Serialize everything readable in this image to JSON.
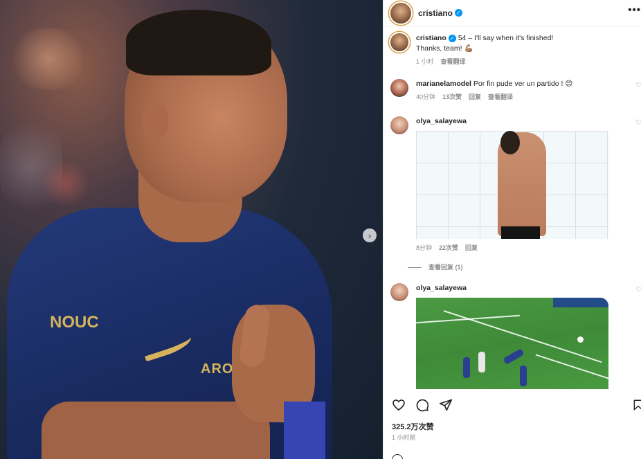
{
  "post": {
    "author": "cristiano",
    "verified_mark": "✓",
    "more_label": "•••",
    "caption": {
      "username": "cristiano",
      "line1": "54 – I'll say when it's finished!",
      "line2": "Thanks, team! 💪🏽",
      "time": "1 小时"
    },
    "photo": {
      "sleeve_logo": "NOUC",
      "sponsor": "AROM"
    },
    "next_label": "›"
  },
  "ui": {
    "translate_label": "查看翻译",
    "reply_label": "回复",
    "view_replies_label": "查看回复 (1)"
  },
  "comments": [
    {
      "username": "marianelamodel",
      "text": "Por fin pude ver un partido ! 😍",
      "time": "40分钟",
      "likes": "13次赞"
    },
    {
      "username": "olya_salayewa",
      "media": "gif-photo",
      "time": "8分钟",
      "likes": "22次赞"
    },
    {
      "username": "olya_salayewa",
      "media": "football-clip"
    }
  ],
  "icons": {
    "like": "heart-icon",
    "comment": "comment-icon",
    "share": "share-icon",
    "save": "bookmark-icon"
  },
  "footer": {
    "likes": "325.2万次赞",
    "time": "1 小时前"
  },
  "colors": {
    "verified": "#0095f6",
    "text": "#262626",
    "muted": "#8e8e8e",
    "jersey": "#1a2c63",
    "gold": "#d6b35c"
  }
}
